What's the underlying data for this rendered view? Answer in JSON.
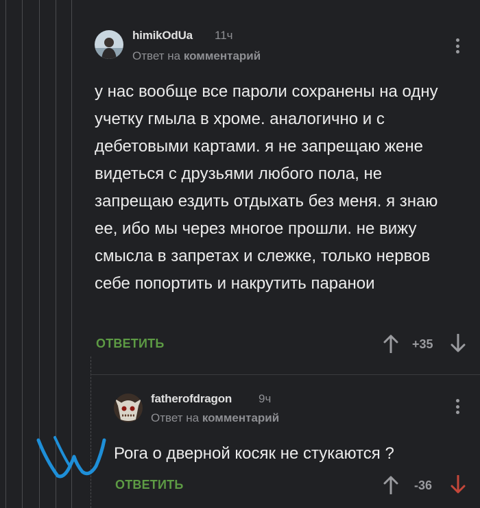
{
  "comments": [
    {
      "username": "himikOdUa",
      "time": "11ч",
      "reply_prefix": "Ответ на",
      "reply_target": "комментарий",
      "text": "у нас вообще все пароли сохранены на одну учетку гмыла в хроме. аналогично и с дебетовыми картами. я не запрещаю жене видеться с друзьями любого пола, не запрещаю ездить отдыхать без меня. я знаю ее, ибо мы через многое прошли. не вижу смысла в запретах и слежке, только нервов себе попортить и накрутить паранои",
      "reply_label": "ОТВЕТИТЬ",
      "score": "+35"
    },
    {
      "username": "fatherofdragon",
      "time": "9ч",
      "reply_prefix": "Ответ на",
      "reply_target": "комментарий",
      "text": "Рога о дверной косяк не стукаются ?",
      "reply_label": "ОТВЕТИТЬ",
      "score": "-36"
    }
  ],
  "colors": {
    "background": "#202124",
    "accent_green": "#5d9b44",
    "downvote_active": "#c4473a",
    "annotation_blue": "#1e8fd8"
  }
}
